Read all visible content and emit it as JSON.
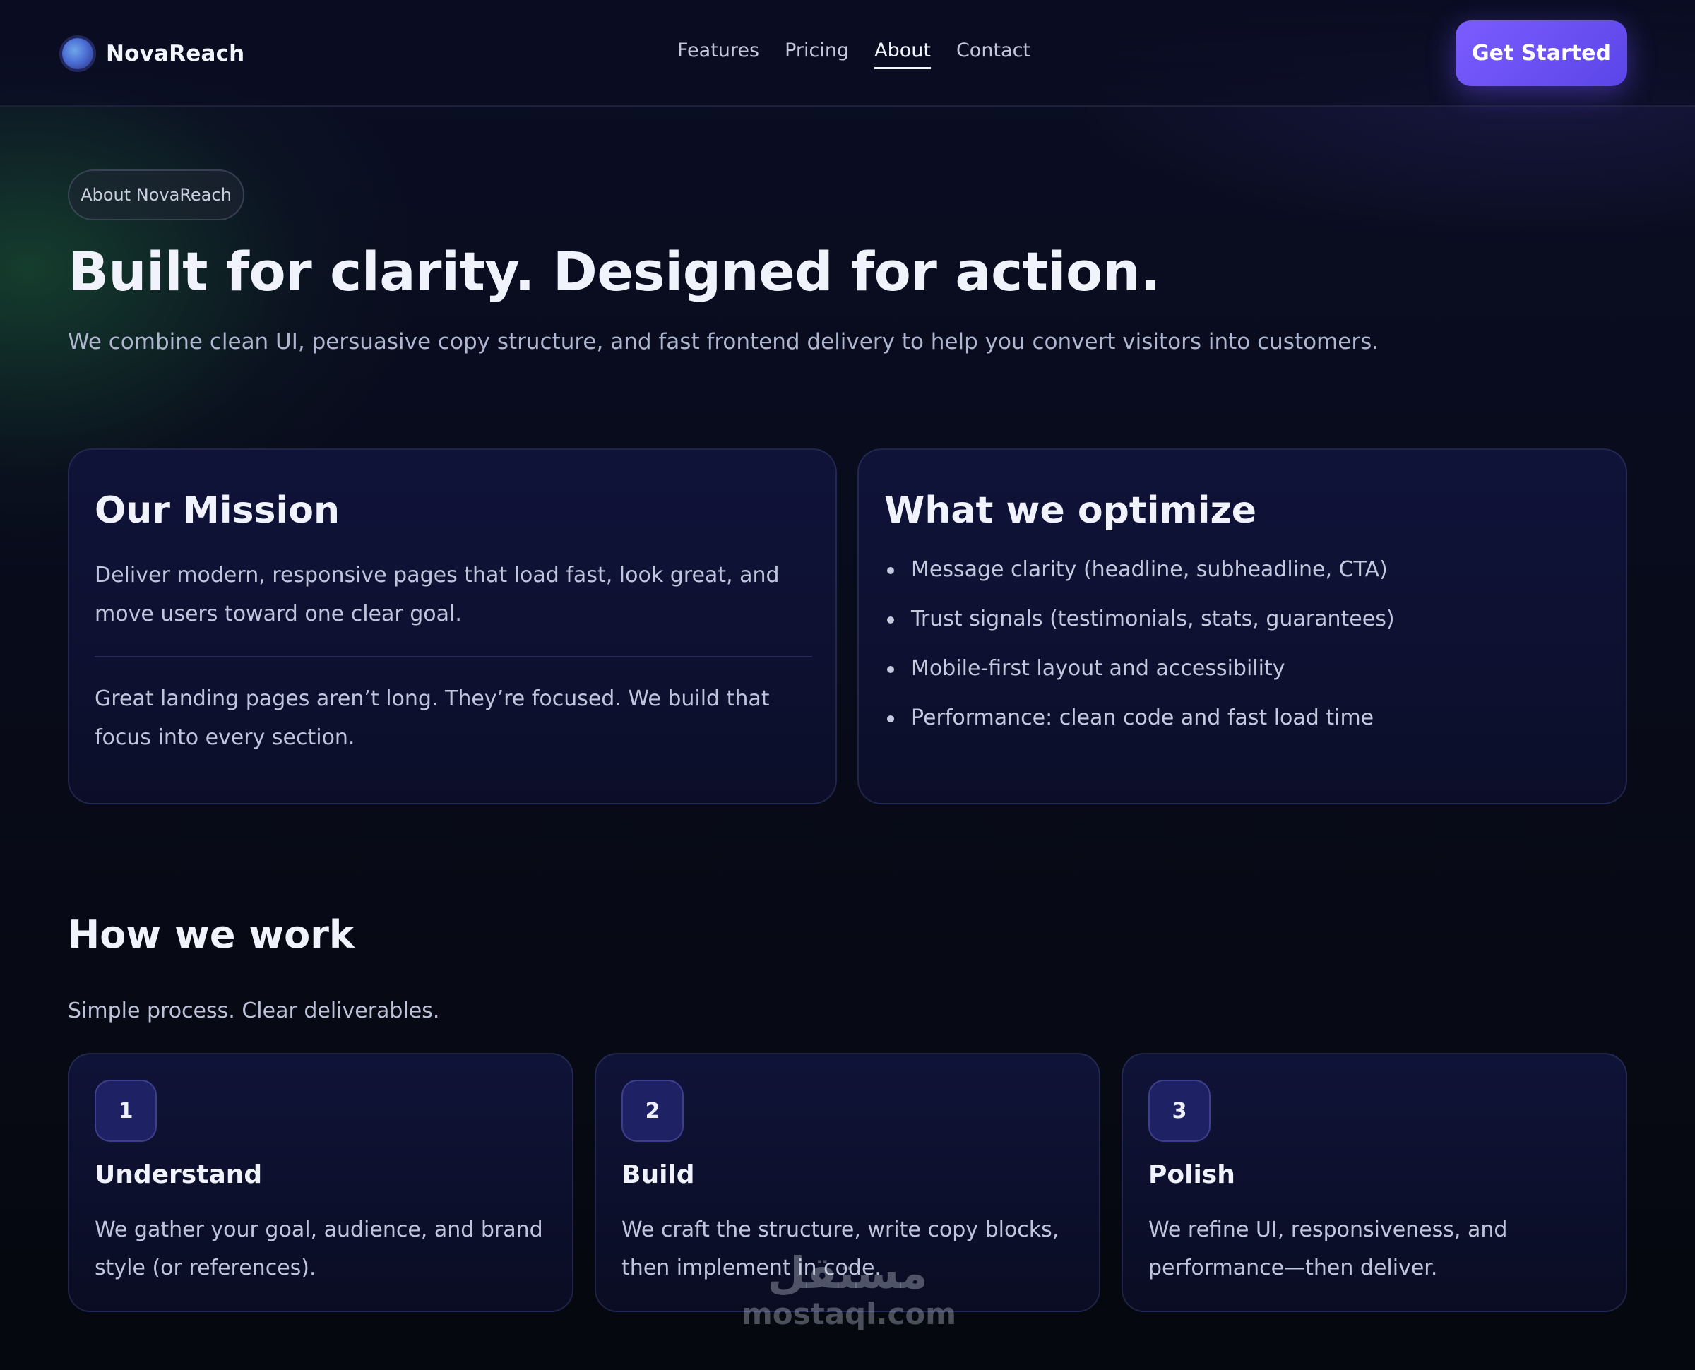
{
  "brand": {
    "name": "NovaReach",
    "logo_icon": "orb-logo-icon"
  },
  "nav": {
    "links": [
      {
        "label": "Features",
        "active": false
      },
      {
        "label": "Pricing",
        "active": false
      },
      {
        "label": "About",
        "active": true
      },
      {
        "label": "Contact",
        "active": false
      }
    ],
    "cta_label": "Get Started"
  },
  "hero": {
    "pill": "About NovaReach",
    "title": "Built for clarity. Designed for action.",
    "subtitle": "We combine clean UI, persuasive copy structure, and fast frontend delivery to help you convert visitors into customers."
  },
  "mission": {
    "title": "Our Mission",
    "paragraph1": "Deliver modern, responsive pages that load fast, look great, and move users toward one clear goal.",
    "paragraph2": "Great landing pages aren’t long. They’re focused. We build that focus into every section."
  },
  "optimize": {
    "title": "What we optimize",
    "items": [
      "Message clarity (headline, subheadline, CTA)",
      "Trust signals (testimonials, stats, guarantees)",
      "Mobile-first layout and accessibility",
      "Performance: clean code and fast load time"
    ]
  },
  "process": {
    "title": "How we work",
    "subtitle": "Simple process. Clear deliverables.",
    "steps": [
      {
        "number": "1",
        "title": "Understand",
        "text": "We gather your goal, audience, and brand style (or references)."
      },
      {
        "number": "2",
        "title": "Build",
        "text": "We craft the structure, write copy blocks, then implement in code."
      },
      {
        "number": "3",
        "title": "Polish",
        "text": "We refine UI, responsiveness, and performance—then deliver."
      }
    ]
  },
  "watermark": {
    "arabic": "مستقل",
    "latin": "mostaql.com"
  },
  "colors": {
    "background": "#070a16",
    "accent": "#7b5cff",
    "card": "#10143a",
    "step_badge": "#1e2163"
  }
}
